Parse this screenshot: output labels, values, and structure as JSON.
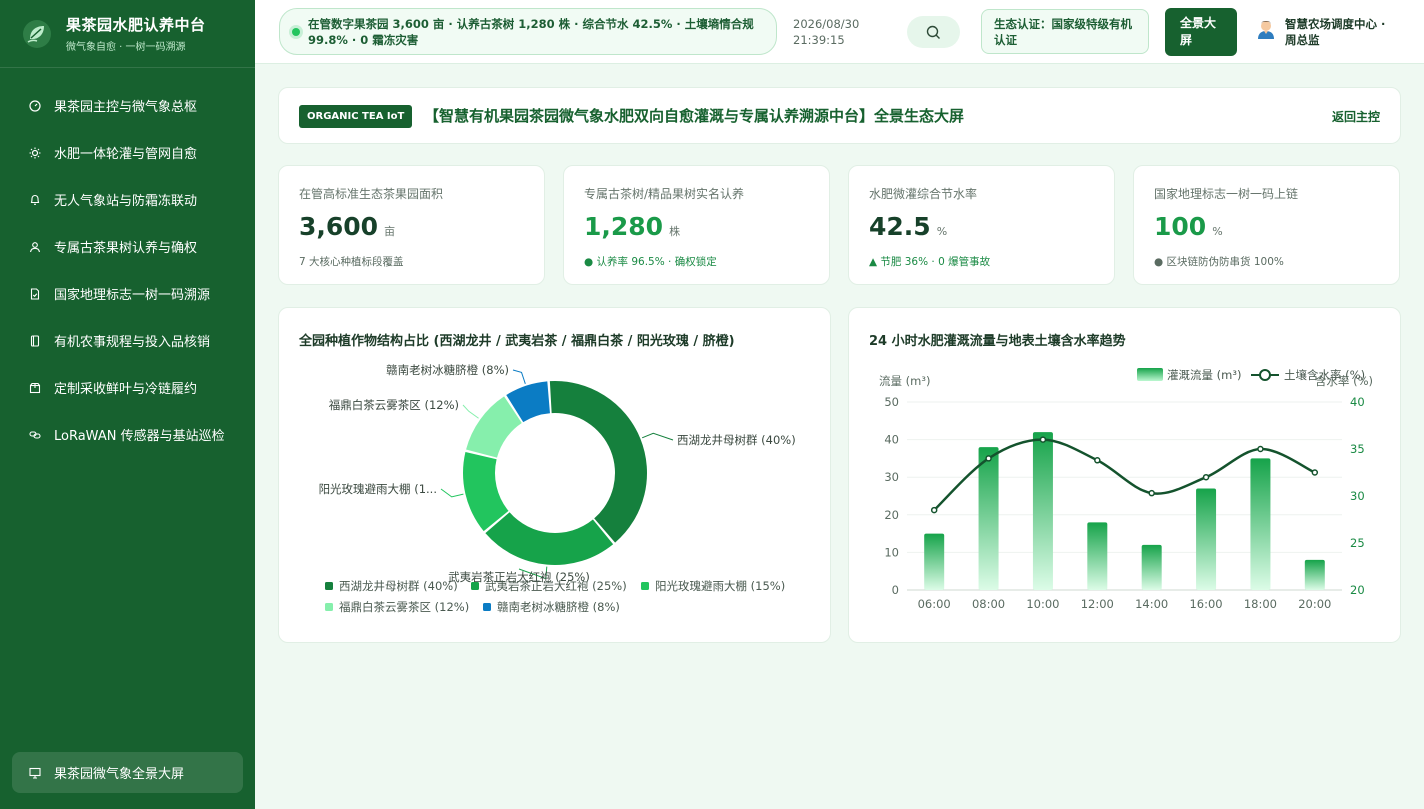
{
  "brand": {
    "title": "果茶园水肥认养中台",
    "subtitle": "微气象自愈 · 一树一码溯源"
  },
  "nav": [
    {
      "label": "果茶园主控与微气象总枢",
      "icon": "dashboard-icon"
    },
    {
      "label": "水肥一体轮灌与管网自愈",
      "icon": "sun-icon"
    },
    {
      "label": "无人气象站与防霜冻联动",
      "icon": "bell-icon"
    },
    {
      "label": "专属古茶果树认养与确权",
      "icon": "user-icon"
    },
    {
      "label": "国家地理标志一树一码溯源",
      "icon": "file-check-icon"
    },
    {
      "label": "有机农事规程与投入品核销",
      "icon": "book-icon"
    },
    {
      "label": "定制采收鲜叶与冷链履约",
      "icon": "package-icon"
    },
    {
      "label": "LoRaWAN 传感器与基站巡检",
      "icon": "link-icon"
    }
  ],
  "nav_bottom": {
    "label": "果茶园微气象全景大屏",
    "icon": "monitor-icon"
  },
  "header": {
    "ticker": "在管数字果茶园 3,600 亩 · 认养古茶树 1,280 株 · 综合节水 42.5% · 土壤墒情合规 99.8% · 0 霜冻灾害",
    "date": "2026/08/30",
    "time": "21:39:15",
    "cert": "生态认证：国家级特级有机认证",
    "fullscreen": "全景大屏",
    "user": "智慧农场调度中心 · 周总监"
  },
  "title_card": {
    "tag": "ORGANIC TEA IoT",
    "title": "【智慧有机果园茶园微气象水肥双向自愈灌溉与专属认养溯源中台】全景生态大屏",
    "back": "返回主控"
  },
  "kpis": [
    {
      "label": "在管高标准生态茶果园面积",
      "value": "3,600",
      "unit": "亩",
      "note": "7 大核心种植标段覆盖",
      "color": "#17412a",
      "note_color": "#5a6b61"
    },
    {
      "label": "专属古茶树/精品果树实名认养",
      "value": "1,280",
      "unit": "株",
      "note": "● 认养率 96.5% · 确权锁定",
      "color": "#1a9a49",
      "note_color": "#1a8a44"
    },
    {
      "label": "水肥微灌综合节水率",
      "value": "42.5",
      "unit": "%",
      "note": "▲ 节肥 36% · 0 爆管事故",
      "color": "#17412a",
      "note_color": "#1a8a44"
    },
    {
      "label": "国家地理标志一树一码上链",
      "value": "100",
      "unit": "%",
      "note": "● 区块链防伪防串货 100%",
      "color": "#1a9a49",
      "note_color": "#5a6b61"
    }
  ],
  "colors": {
    "primary": "#17612f",
    "accent": "#22c55e"
  },
  "chart_data": [
    {
      "type": "pie",
      "title": "全园种植作物结构占比 (西湖龙井 / 武夷岩茶 / 福鼎白茶 / 阳光玫瑰 / 脐橙)",
      "categories": [
        "西湖龙井母树群",
        "武夷岩茶正岩大红袍",
        "阳光玫瑰避雨大棚",
        "福鼎白茶云雾茶区",
        "赣南老树冰糖脐橙"
      ],
      "values": [
        40,
        25,
        15,
        12,
        8
      ],
      "colors": [
        "#15803d",
        "#16a34a",
        "#22c55e",
        "#86efac",
        "#0b7cc4"
      ],
      "slice_labels": [
        "西湖龙井母树群 (40%)",
        "武夷岩茶正岩大红袍 (25%)",
        "阳光玫瑰避雨大棚 (1...",
        "福鼎白茶云雾茶区 (12%)",
        "赣南老树冰糖脐橙 (8%)"
      ],
      "legend": [
        "西湖龙井母树群 (40%)",
        "武夷岩茶正岩大红袍 (25%)",
        "阳光玫瑰避雨大棚 (15%)",
        "福鼎白茶云雾茶区 (12%)",
        "赣南老树冰糖脐橙 (8%)"
      ],
      "legend_position": "bottom"
    },
    {
      "type": "bar",
      "title": "24 小时水肥灌溉流量与地表土壤含水率趋势",
      "x": [
        "06:00",
        "08:00",
        "10:00",
        "12:00",
        "14:00",
        "16:00",
        "18:00",
        "20:00"
      ],
      "series": [
        {
          "name": "灌溉流量 (m³)",
          "type": "bar",
          "axis": "left",
          "values": [
            15,
            38,
            42,
            18,
            12,
            27,
            35,
            8
          ]
        },
        {
          "name": "土壤含水率 (%)",
          "type": "line",
          "axis": "right",
          "values": [
            28.5,
            34,
            36,
            33.8,
            30.3,
            32,
            35,
            32.5
          ]
        }
      ],
      "y_left": {
        "label": "流量 (m³)",
        "ticks": [
          "0",
          "10",
          "20",
          "30",
          "40",
          "50"
        ],
        "range": [
          0,
          50
        ]
      },
      "y_right": {
        "label": "含水率 (%)",
        "ticks": [
          "20",
          "25",
          "30",
          "35",
          "40"
        ],
        "range": [
          20,
          40
        ]
      },
      "legend_position": "top-right"
    }
  ]
}
